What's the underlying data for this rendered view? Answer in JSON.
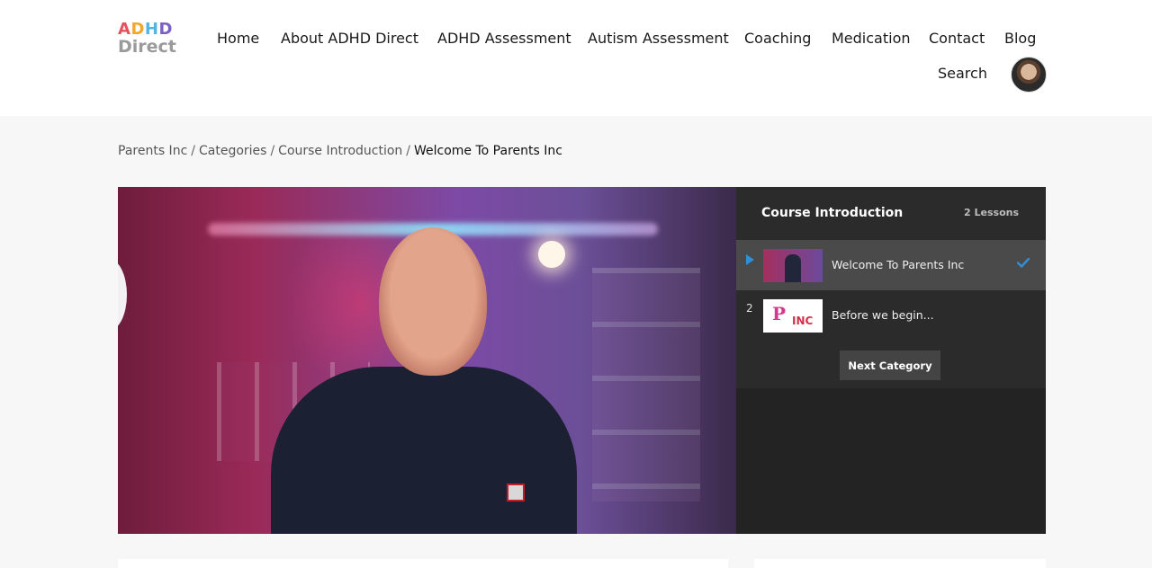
{
  "logo": {
    "line1": [
      "A",
      "D",
      "H",
      "D"
    ],
    "line2": "Direct",
    "alt": "ADHD Direct"
  },
  "nav": {
    "items": [
      "Home",
      "About ADHD Direct",
      "ADHD Assessment",
      "Autism Assessment",
      "Coaching",
      "Medication",
      "Contact",
      "Blog"
    ],
    "search": "Search",
    "avatar_icon": "user-avatar"
  },
  "breadcrumb": {
    "items": [
      "Parents Inc",
      "Categories",
      "Course Introduction"
    ],
    "separator": "/",
    "current": "Welcome To Parents Inc"
  },
  "playlist": {
    "title": "Course Introduction",
    "count": "2 Lessons",
    "lessons": [
      {
        "index": "",
        "label": "Welcome To Parents Inc",
        "active": true,
        "completed": true,
        "status_icon": "play-icon"
      },
      {
        "index": "2",
        "label": "Before we begin...",
        "active": false,
        "completed": false
      }
    ],
    "next_button": "Next Category"
  },
  "colors": {
    "accent": "#2f8fd8",
    "playlist_bg": "#2b2b2b",
    "active_row": "#4a4a4a",
    "page_bg": "#f7f7f7"
  }
}
